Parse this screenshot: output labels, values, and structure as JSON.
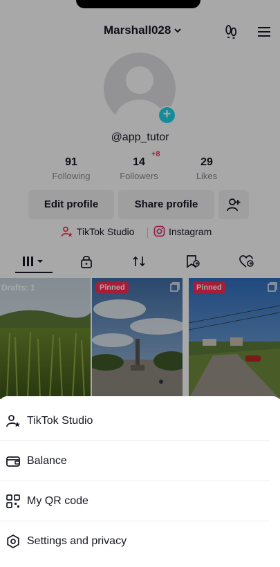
{
  "header": {
    "username": "Marshall028"
  },
  "profile": {
    "handle": "@app_tutor",
    "stats": [
      {
        "value": "91",
        "label": "Following"
      },
      {
        "value": "14",
        "label": "Followers",
        "delta": "+8"
      },
      {
        "value": "29",
        "label": "Likes"
      }
    ],
    "buttons": {
      "edit": "Edit profile",
      "share": "Share profile"
    },
    "links": {
      "studio": "TikTok Studio",
      "instagram": "Instagram"
    }
  },
  "grid": {
    "drafts_label": "Drafts: 1",
    "pinned_label": "Pinned"
  },
  "sheet": {
    "items": [
      {
        "label": "TikTok Studio",
        "icon": "studio-icon"
      },
      {
        "label": "Balance",
        "icon": "wallet-icon"
      },
      {
        "label": "My QR code",
        "icon": "qr-code-icon"
      },
      {
        "label": "Settings and privacy",
        "icon": "gear-icon"
      }
    ]
  },
  "colors": {
    "accent_pink": "#fe2c55",
    "accent_cyan": "#20d5ec",
    "text": "#161823",
    "muted": "#8a8b91"
  }
}
